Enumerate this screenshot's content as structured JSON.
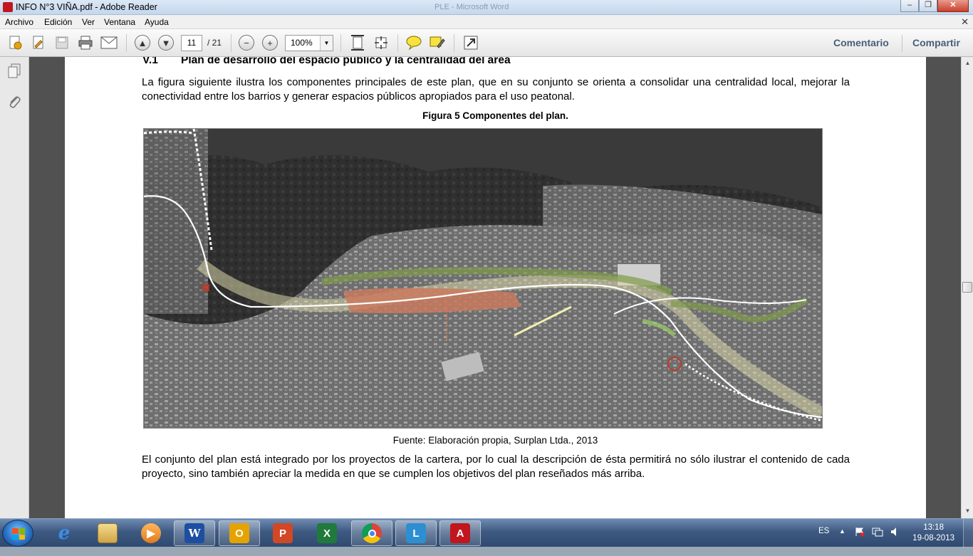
{
  "window": {
    "title": "INFO N°3 VIÑA.pdf - Adobe Reader",
    "background_title": "PLE - Microsoft Word",
    "minimize": "‒",
    "maximize": "❐",
    "close": "✕"
  },
  "menu": {
    "items": [
      "Archivo",
      "Edición",
      "Ver",
      "Ventana",
      "Ayuda"
    ],
    "close_glyph": "✕"
  },
  "toolbar": {
    "page_current": "11",
    "page_total": "/ 21",
    "zoom": "100%",
    "zoom_arrow": "▼",
    "comment_link": "Comentario",
    "share_link": "Compartir"
  },
  "document": {
    "heading_number": "V.1",
    "heading_text": "Plan de desarrollo del espacio público y la centralidad del área",
    "para1": "La figura siguiente ilustra los componentes principales de este plan, que en su conjunto se orienta a consolidar una centralidad local, mejorar la conectividad entre los barrios y generar espacios públicos apropiados para el uso peatonal.",
    "figure_title": "Figura 5 Componentes del plan.",
    "figure_source": "Fuente: Elaboración propia, Surplan Ltda., 2013",
    "para2": "El conjunto del plan está integrado por los proyectos de la cartera, por lo cual la descripción de ésta permitirá no sólo ilustrar el contenido de cada proyecto, sino también apreciar la medida en que se cumplen los objetivos del plan reseñados más arriba."
  },
  "scrollbar": {
    "up": "▲",
    "down": "▼"
  },
  "taskbar": {
    "apps": [
      {
        "name": "internet-explorer",
        "glyph": "e",
        "color": "#1f6fd1"
      },
      {
        "name": "file-explorer",
        "glyph": "",
        "color": "#d9b25a"
      },
      {
        "name": "media-player",
        "glyph": "▶",
        "color": "#e07a1f"
      },
      {
        "name": "word",
        "glyph": "W",
        "color": "#1d4fa0"
      },
      {
        "name": "outlook",
        "glyph": "O",
        "color": "#e6a300"
      },
      {
        "name": "powerpoint",
        "glyph": "P",
        "color": "#d24726"
      },
      {
        "name": "excel",
        "glyph": "X",
        "color": "#1f7a3c"
      },
      {
        "name": "chrome",
        "glyph": "",
        "color": "#dd4b39"
      },
      {
        "name": "lync",
        "glyph": "L",
        "color": "#2d8fd1"
      },
      {
        "name": "adobe-reader",
        "glyph": "A",
        "color": "#c0161c"
      }
    ],
    "language": "ES",
    "time": "13:18",
    "date": "19-08-2013"
  }
}
